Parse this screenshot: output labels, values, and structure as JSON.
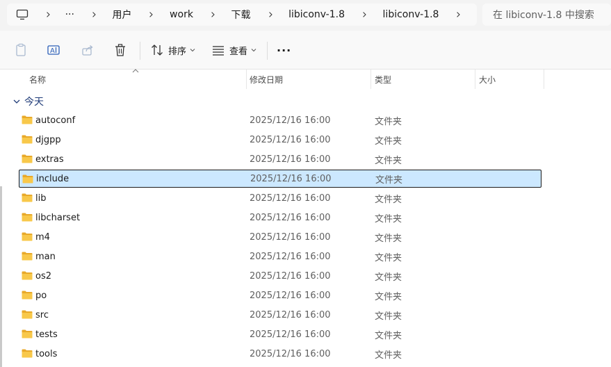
{
  "address_bar": {
    "breadcrumbs": [
      "用户",
      "work",
      "下载",
      "libiconv-1.8",
      "libiconv-1.8"
    ],
    "overflow": "···"
  },
  "search": {
    "placeholder": "在 libiconv-1.8 中搜索"
  },
  "toolbar": {
    "sort_label": "排序",
    "view_label": "查看",
    "more_label": "···"
  },
  "columns": {
    "name": "名称",
    "modified": "修改日期",
    "type": "类型",
    "size": "大小"
  },
  "group": {
    "label": "今天"
  },
  "rows": [
    {
      "name": "autoconf",
      "modified": "2025/12/16 16:00",
      "type": "文件夹"
    },
    {
      "name": "djgpp",
      "modified": "2025/12/16 16:00",
      "type": "文件夹"
    },
    {
      "name": "extras",
      "modified": "2025/12/16 16:00",
      "type": "文件夹"
    },
    {
      "name": "include",
      "modified": "2025/12/16 16:00",
      "type": "文件夹",
      "selected": true
    },
    {
      "name": "lib",
      "modified": "2025/12/16 16:00",
      "type": "文件夹"
    },
    {
      "name": "libcharset",
      "modified": "2025/12/16 16:00",
      "type": "文件夹"
    },
    {
      "name": "m4",
      "modified": "2025/12/16 16:00",
      "type": "文件夹"
    },
    {
      "name": "man",
      "modified": "2025/12/16 16:00",
      "type": "文件夹"
    },
    {
      "name": "os2",
      "modified": "2025/12/16 16:00",
      "type": "文件夹"
    },
    {
      "name": "po",
      "modified": "2025/12/16 16:00",
      "type": "文件夹"
    },
    {
      "name": "src",
      "modified": "2025/12/16 16:00",
      "type": "文件夹"
    },
    {
      "name": "tests",
      "modified": "2025/12/16 16:00",
      "type": "文件夹"
    },
    {
      "name": "tools",
      "modified": "2025/12/16 16:00",
      "type": "文件夹"
    }
  ],
  "colors": {
    "selection": "#cce8ff",
    "folder": "#f8c84a",
    "group_text": "#1f3b78"
  }
}
